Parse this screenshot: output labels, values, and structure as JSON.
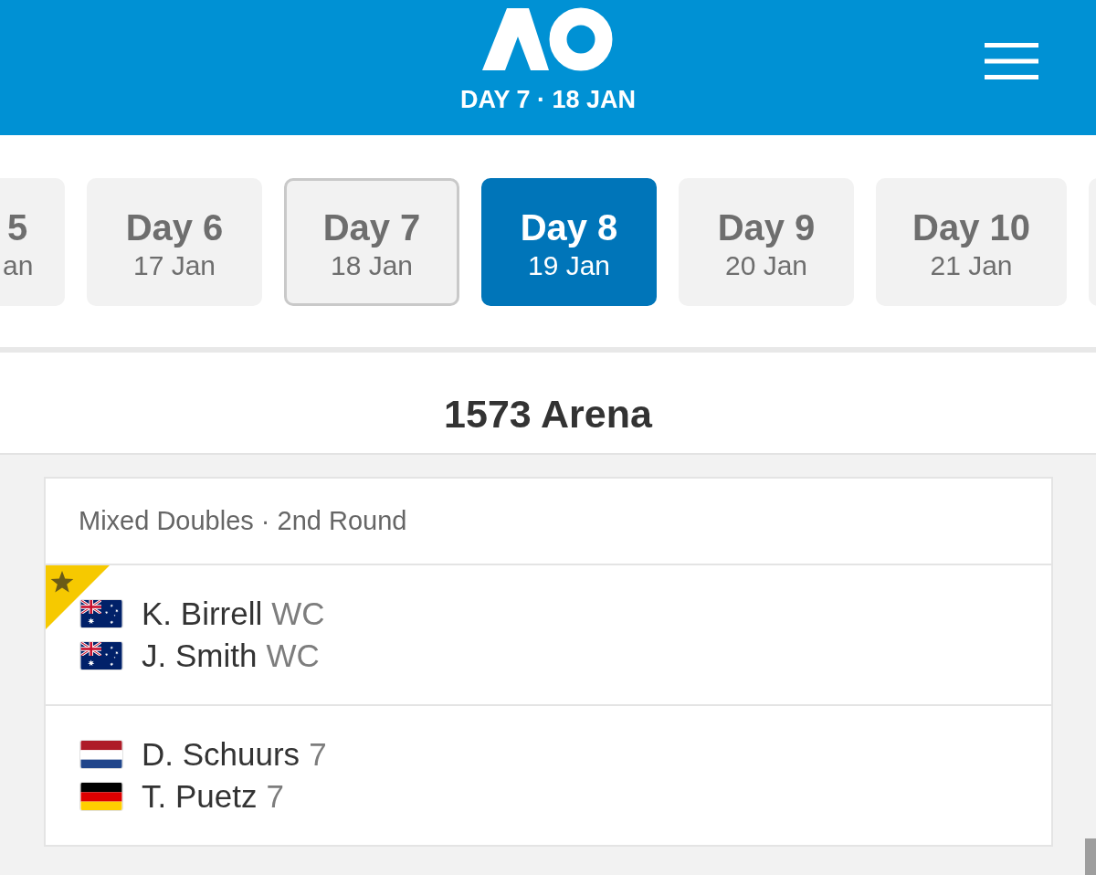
{
  "header": {
    "subtitle": "DAY 7 · 18 JAN"
  },
  "days": [
    {
      "label": "5",
      "date": "an",
      "selected": false,
      "today": false
    },
    {
      "label": "Day 6",
      "date": "17 Jan",
      "selected": false,
      "today": false
    },
    {
      "label": "Day 7",
      "date": "18 Jan",
      "selected": false,
      "today": true
    },
    {
      "label": "Day 8",
      "date": "19 Jan",
      "selected": true,
      "today": false
    },
    {
      "label": "Day 9",
      "date": "20 Jan",
      "selected": false,
      "today": false
    },
    {
      "label": "Day 10",
      "date": "21 Jan",
      "selected": false,
      "today": false
    }
  ],
  "court": {
    "name": "1573 Arena"
  },
  "match": {
    "event": "Mixed Doubles · 2nd Round",
    "teams": [
      {
        "starred": true,
        "players": [
          {
            "kind": "australia",
            "name": "K. Birrell",
            "tag": "WC"
          },
          {
            "kind": "australia",
            "name": "J. Smith",
            "tag": "WC"
          }
        ]
      },
      {
        "starred": false,
        "players": [
          {
            "kind": "netherlands",
            "name": "D. Schuurs",
            "tag": "7"
          },
          {
            "kind": "germany",
            "name": "T. Puetz",
            "tag": "7"
          }
        ]
      }
    ]
  }
}
